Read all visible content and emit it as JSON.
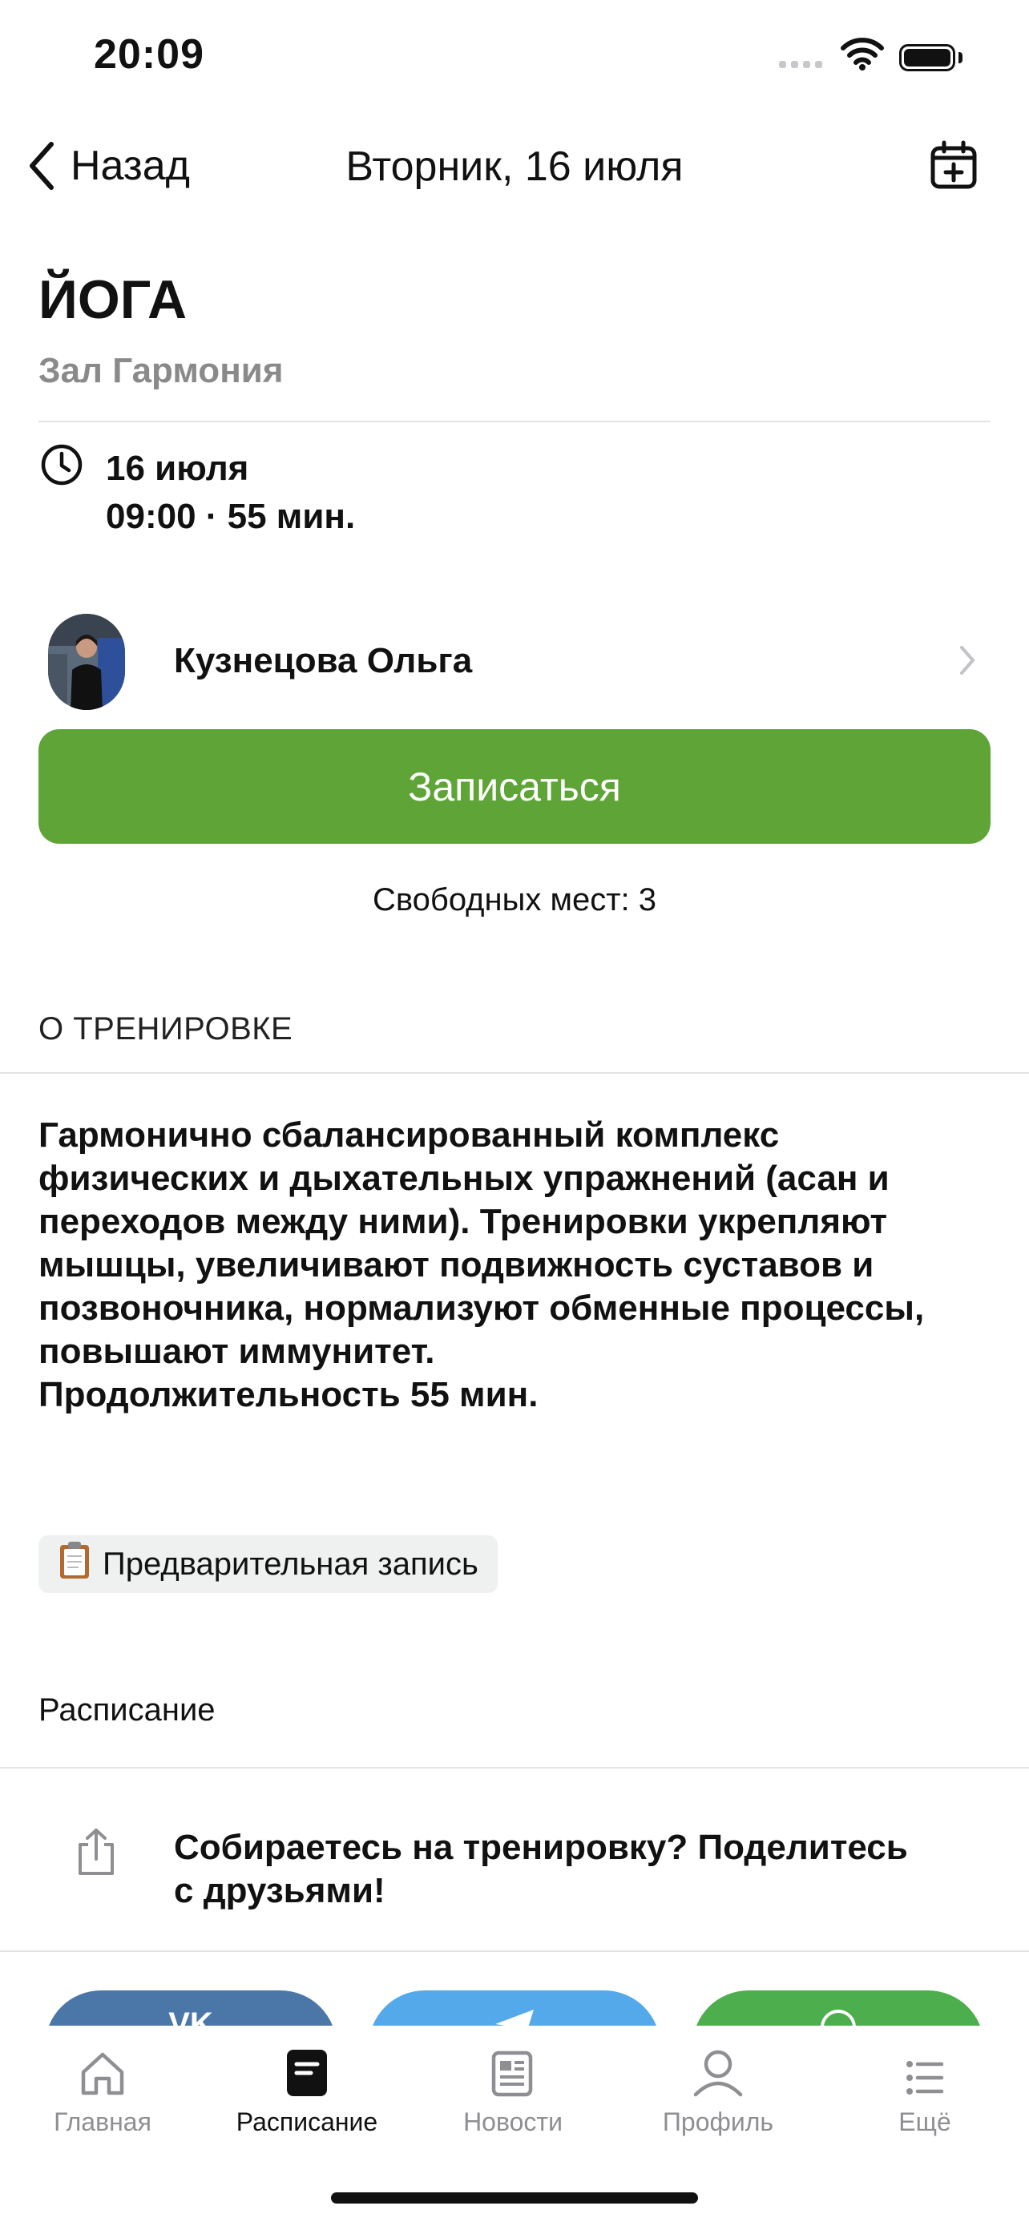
{
  "status_bar": {
    "time": "20:09"
  },
  "nav": {
    "back_label": "Назад",
    "title": "Вторник, 16 июля"
  },
  "class": {
    "title": "ЙОГА",
    "hall": "Зал Гармония",
    "date": "16 июля",
    "time_duration": "09:00 · 55 мин."
  },
  "trainer": {
    "name": "Кузнецова Ольга"
  },
  "signup": {
    "button_label": "Записаться",
    "free_places": "Свободных мест: 3"
  },
  "about": {
    "section_label": "О ТРЕНИРОВКЕ",
    "lines": [
      "Гармонично сбалансированный комплекс",
      "физических и дыхательных упражнений (асан и",
      "переходов между ними). Тренировки укрепляют",
      "мышцы, увеличивают подвижность суставов и",
      "позвоночника, нормализуют обменные процессы,",
      "повышают иммунитет.",
      "Продолжительность 55 мин."
    ]
  },
  "tag": {
    "icon": "clipboard-icon",
    "label": "Предварительная запись"
  },
  "schedule": {
    "label": "Расписание"
  },
  "share": {
    "text_line1": "Собираетесь на тренировку? Поделитесь",
    "text_line2": "с друзьями!"
  },
  "social": {
    "colors": [
      "#4a76a8",
      "#54a9eb",
      "#4cae4c"
    ],
    "icons": [
      "vk-icon",
      "telegram-icon",
      "whatsapp-icon"
    ]
  },
  "tabbar": {
    "items": [
      {
        "label": "Главная",
        "icon": "home-icon",
        "active": false
      },
      {
        "label": "Расписание",
        "icon": "schedule-icon",
        "active": true
      },
      {
        "label": "Новости",
        "icon": "news-icon",
        "active": false
      },
      {
        "label": "Профиль",
        "icon": "profile-icon",
        "active": false
      },
      {
        "label": "Ещё",
        "icon": "more-icon",
        "active": false
      }
    ]
  },
  "colors": {
    "accent": "#5ea437",
    "muted": "#8e8e93"
  }
}
